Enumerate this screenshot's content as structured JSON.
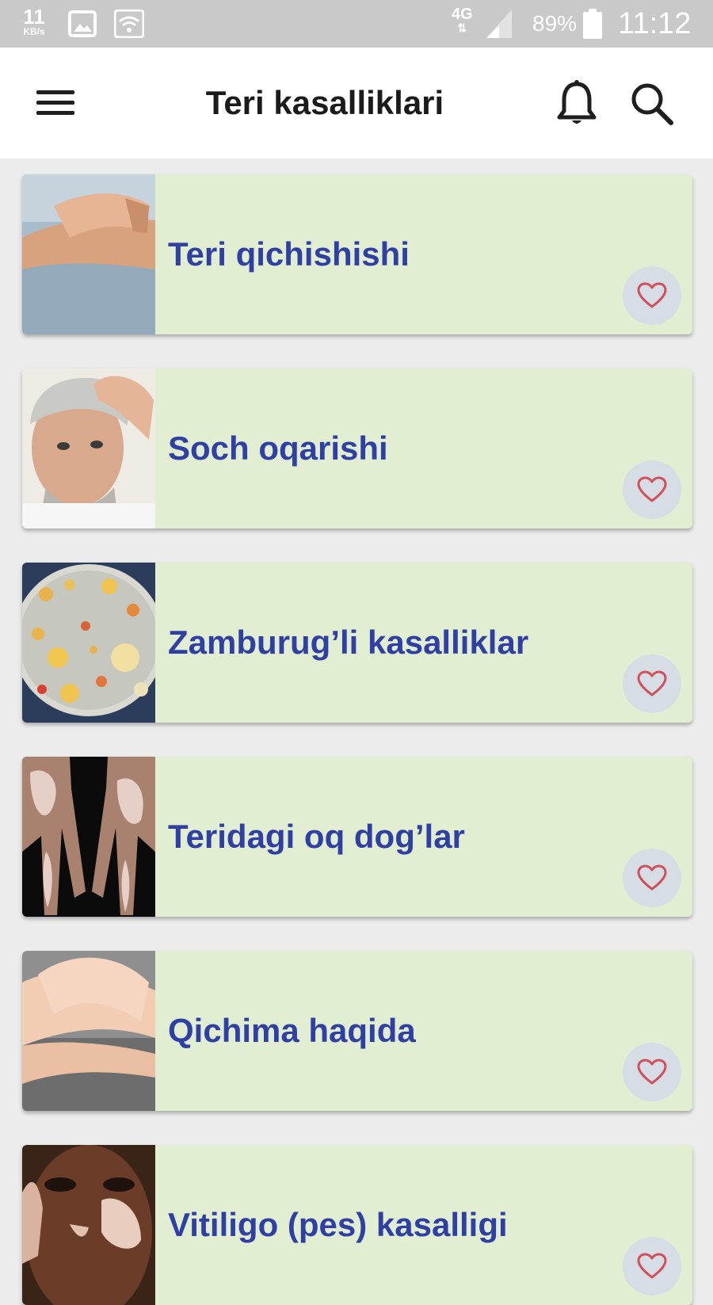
{
  "status_bar": {
    "speed": "11",
    "speed_unit": "KB/s",
    "network": "4G",
    "battery": "89%",
    "time": "11:12",
    "icons": [
      "gallery-icon",
      "wifi-icon",
      "signal-icon",
      "battery-icon"
    ]
  },
  "app_bar": {
    "title": "Teri kasalliklari",
    "icons": [
      "menu-icon",
      "bell-icon",
      "search-icon"
    ]
  },
  "colors": {
    "card_background": "#e2eed1",
    "title_text": "#2f3fa3",
    "favorite_heart": "#d2505c",
    "favorite_button": "#d6dde4",
    "page_background": "#ececec"
  },
  "items": [
    {
      "title": "Teri qichishishi",
      "image": "arm-scratching-photo"
    },
    {
      "title": "Soch oqarishi",
      "image": "grey-haired-man-photo"
    },
    {
      "title": "Zamburug’li kasalliklar",
      "image": "petri-dish-photo"
    },
    {
      "title": "Teridagi oq dog’lar",
      "image": "vitiligo-hands-photo"
    },
    {
      "title": "Qichima haqida",
      "image": "scratching-wrist-photo"
    },
    {
      "title": "Vitiligo (pes) kasalligi",
      "image": "vitiligo-face-photo"
    }
  ]
}
